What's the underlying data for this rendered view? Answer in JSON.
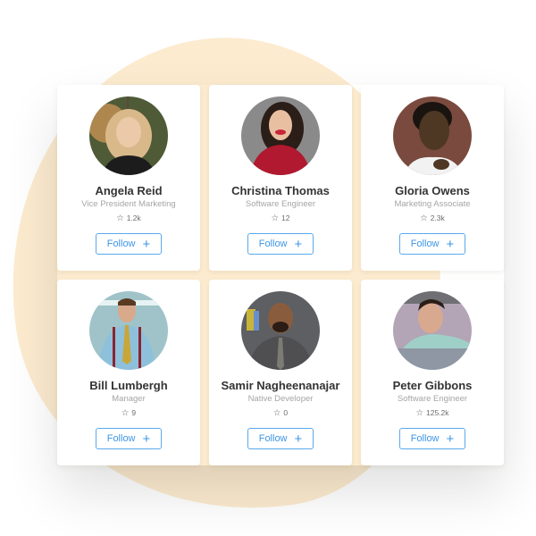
{
  "colors": {
    "blob": "#fcebcf",
    "accent": "#3c96e6",
    "name_text": "#333333",
    "subtitle_text": "#a5a5a5"
  },
  "follow_button": {
    "label": "Follow",
    "icon": "plus-icon",
    "icon_glyph": "+"
  },
  "star_glyph": "☆",
  "profiles": [
    {
      "name": "Angela Reid",
      "title": "Vice President Marketing",
      "stars": "1.2k"
    },
    {
      "name": "Christina Thomas",
      "title": "Software Engineer",
      "stars": "12"
    },
    {
      "name": "Gloria Owens",
      "title": "Marketing Associate",
      "stars": "2.3k"
    },
    {
      "name": "Bill Lumbergh",
      "title": "Manager",
      "stars": "9"
    },
    {
      "name": "Samir Nagheenanajar",
      "title": "Native Developer",
      "stars": "0"
    },
    {
      "name": "Peter Gibbons",
      "title": "Software Engineer",
      "stars": "125.2k"
    }
  ]
}
